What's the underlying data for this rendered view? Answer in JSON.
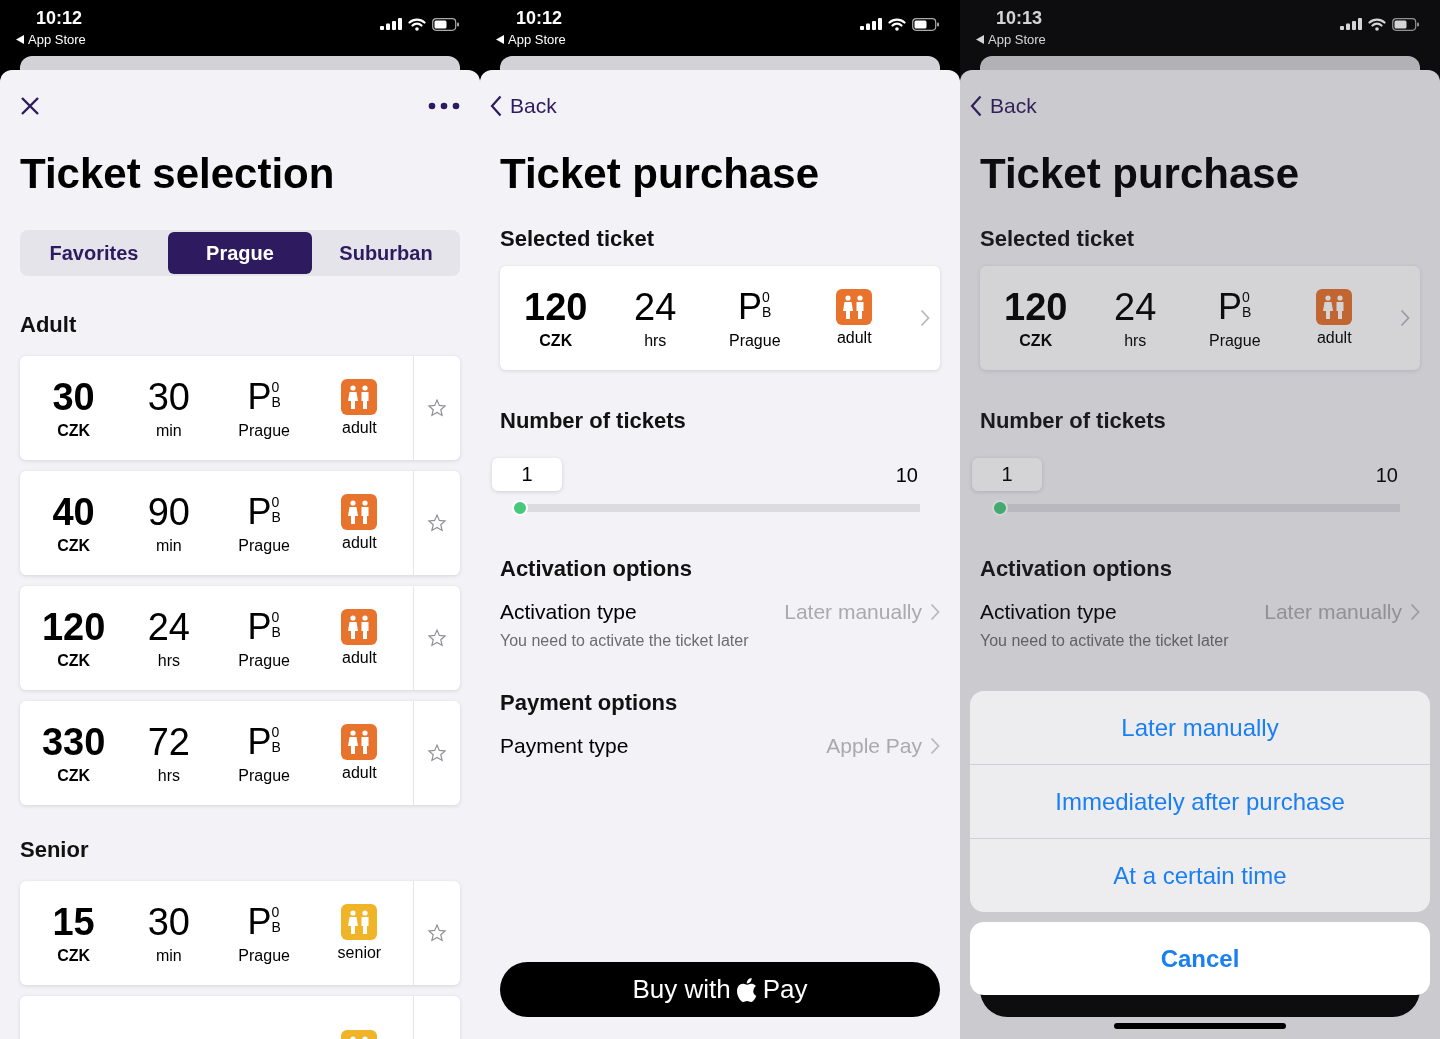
{
  "screens": [
    {
      "kind": "selection",
      "status_bar": {
        "time": "10:12",
        "back_label": "App Store"
      },
      "title": "Ticket selection",
      "segments": [
        {
          "label": "Favorites",
          "selected": false
        },
        {
          "label": "Prague",
          "selected": true
        },
        {
          "label": "Suburban",
          "selected": false
        }
      ],
      "sections": [
        {
          "heading": "Adult",
          "tickets": [
            {
              "kind": "adult",
              "price": "30",
              "currency": "CZK",
              "duration": "30",
              "unit": "min",
              "zone": {
                "letter": "P",
                "sup": "0",
                "sub": "B"
              },
              "city": "Prague",
              "passenger": "adult"
            },
            {
              "kind": "adult",
              "price": "40",
              "currency": "CZK",
              "duration": "90",
              "unit": "min",
              "zone": {
                "letter": "P",
                "sup": "0",
                "sub": "B"
              },
              "city": "Prague",
              "passenger": "adult"
            },
            {
              "kind": "adult",
              "price": "120",
              "currency": "CZK",
              "duration": "24",
              "unit": "hrs",
              "zone": {
                "letter": "P",
                "sup": "0",
                "sub": "B"
              },
              "city": "Prague",
              "passenger": "adult"
            },
            {
              "kind": "adult",
              "price": "330",
              "currency": "CZK",
              "duration": "72",
              "unit": "hrs",
              "zone": {
                "letter": "P",
                "sup": "0",
                "sub": "B"
              },
              "city": "Prague",
              "passenger": "adult"
            }
          ]
        },
        {
          "heading": "Senior",
          "tickets": [
            {
              "kind": "senior",
              "price": "15",
              "currency": "CZK",
              "duration": "30",
              "unit": "min",
              "zone": {
                "letter": "P",
                "sup": "0",
                "sub": "B"
              },
              "city": "Prague",
              "passenger": "senior"
            },
            {
              "kind": "senior",
              "cut_off": true
            }
          ]
        }
      ]
    },
    {
      "kind": "purchase",
      "status_bar": {
        "time": "10:12",
        "back_label": "App Store"
      },
      "back": "Back",
      "title": "Ticket purchase",
      "selected_heading": "Selected ticket",
      "ticket": {
        "kind": "adult",
        "price": "120",
        "currency": "CZK",
        "duration": "24",
        "unit": "hrs",
        "zone": {
          "letter": "P",
          "sup": "0",
          "sub": "B"
        },
        "city": "Prague",
        "passenger": "adult"
      },
      "count_heading": "Number of tickets",
      "count_slider": {
        "value": "1",
        "max": "10",
        "level": 0
      },
      "activation_heading": "Activation options",
      "activation": {
        "label": "Activation type",
        "value": "Later manually",
        "hint": "You need to activate the ticket later"
      },
      "payment_heading": "Payment options",
      "payment": {
        "label": "Payment type",
        "value": "Apple Pay"
      },
      "buy_button": {
        "prefix": "Buy with",
        "suffix": "Pay"
      }
    },
    {
      "kind": "purchase",
      "status_bar": {
        "time": "10:13",
        "back_label": "App Store"
      },
      "back": "Back",
      "title": "Ticket purchase",
      "selected_heading": "Selected ticket",
      "ticket": {
        "kind": "adult",
        "price": "120",
        "currency": "CZK",
        "duration": "24",
        "unit": "hrs",
        "zone": {
          "letter": "P",
          "sup": "0",
          "sub": "B"
        },
        "city": "Prague",
        "passenger": "adult"
      },
      "count_heading": "Number of tickets",
      "count_slider": {
        "value": "1",
        "max": "10",
        "level": 0
      },
      "activation_heading": "Activation options",
      "activation": {
        "label": "Activation type",
        "value": "Later manually",
        "hint": "You need to activate the ticket later"
      },
      "buy_button": {
        "text_hidden": true
      },
      "action_sheet": {
        "options": [
          "Later manually",
          "Immediately after purchase",
          "At a certain time"
        ],
        "cancel": "Cancel"
      }
    }
  ]
}
